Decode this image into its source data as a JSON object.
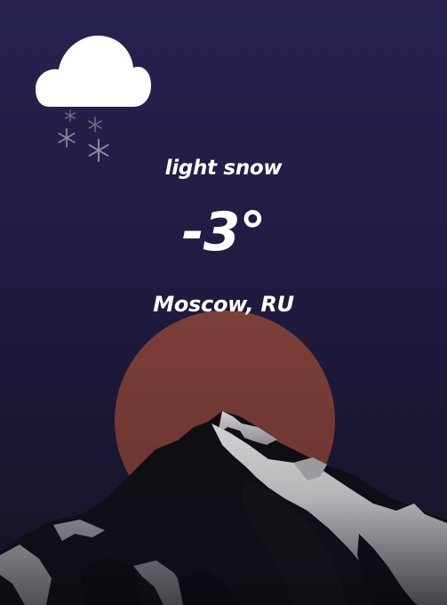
{
  "weather": {
    "icon": "cloud-snow-icon",
    "description": "light snow",
    "temperature": "-3°",
    "location": "Moscow, RU"
  },
  "colors": {
    "sky_top": "#27224f",
    "sky_bottom": "#171426",
    "sun": "#7a3f39",
    "mountain_dark": "#0f0d14",
    "mountain_light": "#bdbcbe",
    "text": "#ffffff"
  }
}
